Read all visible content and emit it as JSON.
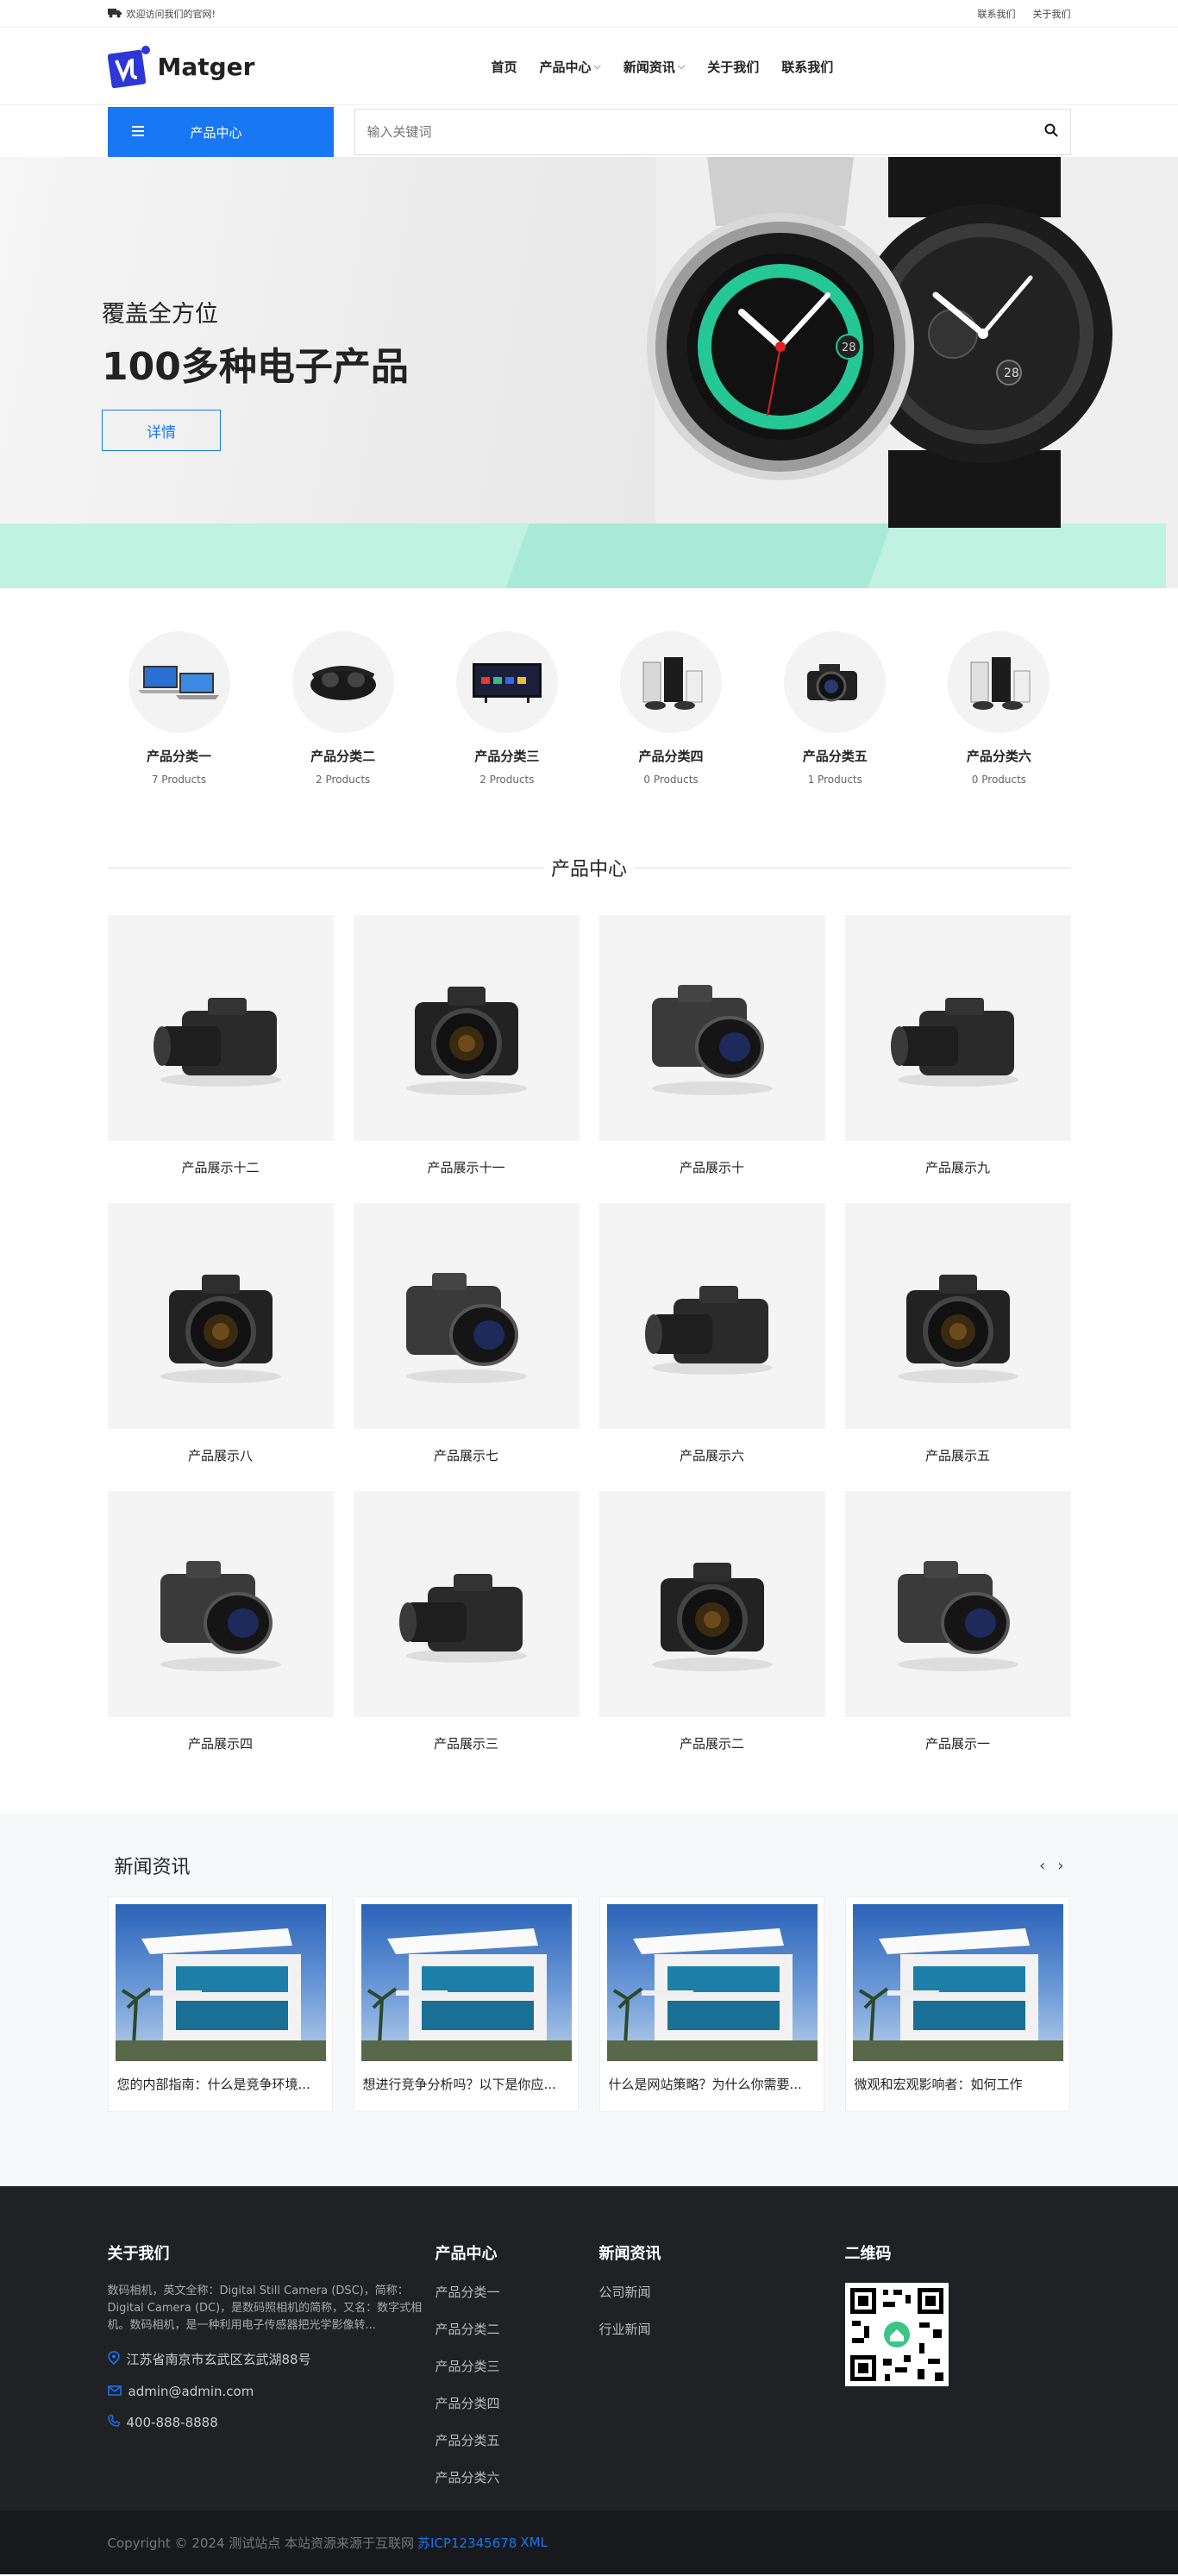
{
  "topbar": {
    "welcome": "欢迎访问我们的官网!",
    "links": [
      "联系我们",
      "关于我们"
    ]
  },
  "header": {
    "logo": "Matger",
    "nav": [
      {
        "label": "首页",
        "dropdown": false
      },
      {
        "label": "产品中心",
        "dropdown": true
      },
      {
        "label": "新闻资讯",
        "dropdown": true
      },
      {
        "label": "关于我们",
        "dropdown": false
      },
      {
        "label": "联系我们",
        "dropdown": false
      }
    ]
  },
  "catbar": {
    "button": "产品中心",
    "search_placeholder": "输入关键词"
  },
  "banner": {
    "subtitle": "覆盖全方位",
    "title": "100多种电子产品",
    "button": "详情",
    "watch_date": "28"
  },
  "categories": [
    {
      "name": "产品分类一",
      "count": "7 Products"
    },
    {
      "name": "产品分类二",
      "count": "2 Products"
    },
    {
      "name": "产品分类三",
      "count": "2 Products"
    },
    {
      "name": "产品分类四",
      "count": "0 Products"
    },
    {
      "name": "产品分类五",
      "count": "1 Products"
    },
    {
      "name": "产品分类六",
      "count": "0 Products"
    }
  ],
  "products": {
    "title": "产品中心",
    "items": [
      "产品展示十二",
      "产品展示十一",
      "产品展示十",
      "产品展示九",
      "产品展示八",
      "产品展示七",
      "产品展示六",
      "产品展示五",
      "产品展示四",
      "产品展示三",
      "产品展示二",
      "产品展示一"
    ]
  },
  "news": {
    "title": "新闻资讯",
    "items": [
      "您的内部指南：什么是竞争环境...",
      "想进行竞争分析吗？以下是你应...",
      "什么是网站策略？为什么你需要...",
      "微观和宏观影响者：如何工作"
    ]
  },
  "footer": {
    "about": {
      "title": "关于我们",
      "text": "数码相机，英文全称：Digital Still Camera (DSC)，简称：Digital Camera (DC)，是数码照相机的简称，又名：数字式相机。数码相机，是一种利用电子传感器把光学影像转...",
      "address": "江苏省南京市玄武区玄武湖88号",
      "email": "admin@admin.com",
      "phone": "400-888-8888"
    },
    "products": {
      "title": "产品中心",
      "links": [
        "产品分类一",
        "产品分类二",
        "产品分类三",
        "产品分类四",
        "产品分类五",
        "产品分类六"
      ]
    },
    "news": {
      "title": "新闻资讯",
      "links": [
        "公司新闻",
        "行业新闻"
      ]
    },
    "qr": {
      "title": "二维码"
    }
  },
  "copyright": {
    "text": "Copyright © 2024 测试站点 本站资源来源于互联网",
    "icp": "苏ICP12345678",
    "xml": "XML"
  },
  "colors": {
    "accent": "#1877f2",
    "footer_bg": "#202125",
    "mint": "#bff2e1"
  }
}
